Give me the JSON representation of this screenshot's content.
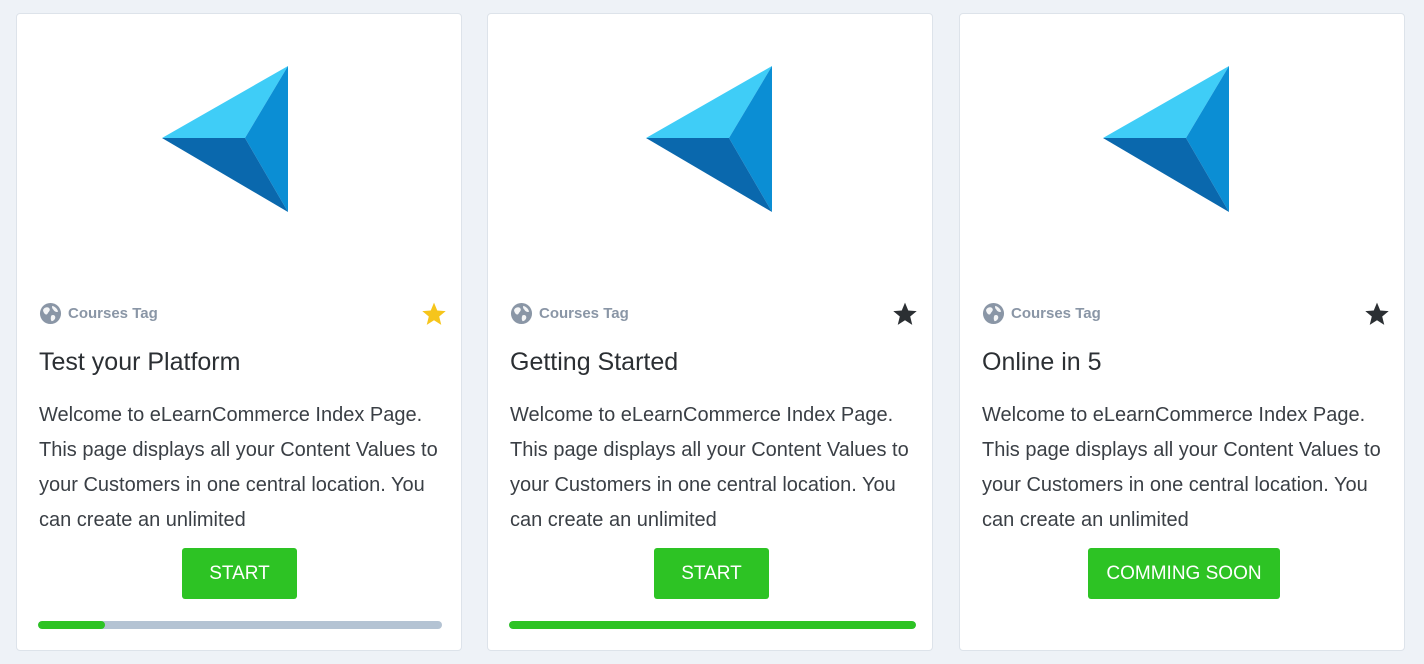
{
  "colors": {
    "accent_green": "#2dc324",
    "track_gray": "#b4c3d3",
    "star_favorite": "#f6c51b",
    "star_default": "#2b2f33",
    "tag_gray": "#8a96a6"
  },
  "cards": [
    {
      "tag_icon": "globe-icon",
      "tag": "Courses Tag",
      "star_icon": "star-icon",
      "starred": true,
      "title": "Test your Platform",
      "description": "Welcome to eLearnCommerce Index Page. This page displays all your Content Values to your Customers in one central location. You can create an unlimited",
      "button_label": "START",
      "has_progress": true,
      "progress": 0.165
    },
    {
      "tag_icon": "globe-icon",
      "tag": "Courses Tag",
      "star_icon": "star-icon",
      "starred": false,
      "title": "Getting Started",
      "description": "Welcome to eLearnCommerce Index Page. This page displays all your Content Values to your Customers in one central location. You can create an unlimited",
      "button_label": "START",
      "has_progress": true,
      "progress": 1.0
    },
    {
      "tag_icon": "globe-icon",
      "tag": "Courses Tag",
      "star_icon": "star-icon",
      "starred": false,
      "title": "Online in 5",
      "description": "Welcome to eLearnCommerce Index Page. This page displays all your Content Values to your Customers in one central location. You can create an unlimited",
      "button_label": "COMMING SOON",
      "has_progress": false,
      "progress": null
    }
  ]
}
